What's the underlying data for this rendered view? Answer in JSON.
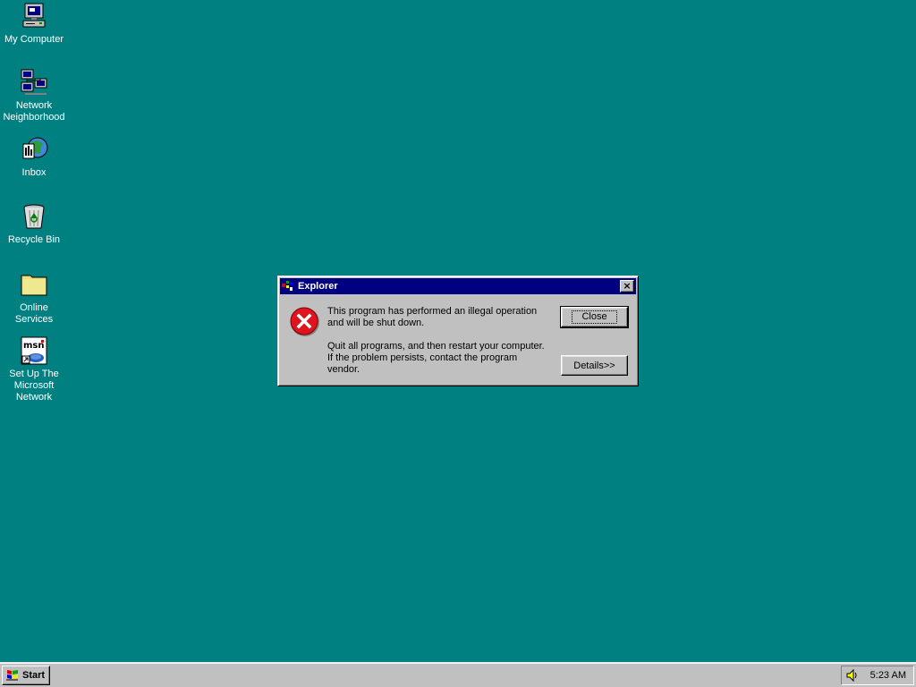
{
  "desktop": {
    "background": "#008080",
    "icons": [
      {
        "label": "My Computer",
        "icon": "computer-icon"
      },
      {
        "label": "Network\nNeighborhood",
        "icon": "network-icon"
      },
      {
        "label": "Inbox",
        "icon": "inbox-icon"
      },
      {
        "label": "Recycle Bin",
        "icon": "recycle-bin-icon"
      },
      {
        "label": "Online\nServices",
        "icon": "folder-icon"
      },
      {
        "label": "Set Up The\nMicrosoft\nNetwork",
        "icon": "msn-icon"
      }
    ]
  },
  "dialog": {
    "title": "Explorer",
    "close_glyph": "×",
    "message_1": "This program has performed an illegal operation and will be shut down.",
    "message_2": "Quit all programs, and then restart your computer. If the problem persists, contact the program vendor.",
    "close_button": "Close",
    "details_button": "Details>>",
    "icon": "error-icon",
    "title_color": "#000080"
  },
  "taskbar": {
    "start_label": "Start",
    "clock": "5:23 AM"
  }
}
